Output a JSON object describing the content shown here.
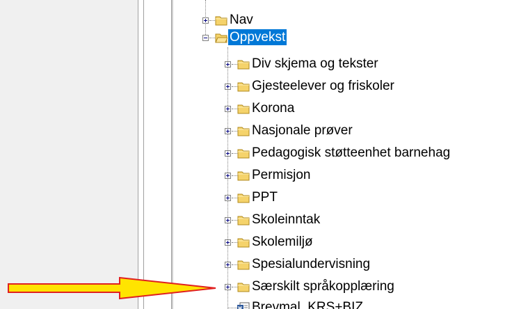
{
  "colors": {
    "selection": "#0078d7",
    "folder_fill": "#f5d36b",
    "folder_stroke": "#b08a1e",
    "arrow_fill": "#ffe400",
    "arrow_stroke": "#e02020"
  },
  "tree": {
    "top_nodes": [
      {
        "label": "Nav",
        "expanded": false,
        "icon": "folder-icon"
      },
      {
        "label": "Oppvekst",
        "expanded": true,
        "selected": true,
        "icon": "folder-open-icon"
      }
    ],
    "children": [
      {
        "label": "Div skjema og tekster",
        "icon": "folder-icon"
      },
      {
        "label": "Gjesteelever og friskoler",
        "icon": "folder-icon"
      },
      {
        "label": "Korona",
        "icon": "folder-icon"
      },
      {
        "label": "Nasjonale prøver",
        "icon": "folder-icon"
      },
      {
        "label": "Pedagogisk støtteenhet barnehag",
        "icon": "folder-icon"
      },
      {
        "label": "Permisjon",
        "icon": "folder-icon"
      },
      {
        "label": "PPT",
        "icon": "folder-icon"
      },
      {
        "label": "Skoleinntak",
        "icon": "folder-icon"
      },
      {
        "label": "Skolemiljø",
        "icon": "folder-icon"
      },
      {
        "label": "Spesialundervisning",
        "icon": "folder-icon"
      },
      {
        "label": "Særskilt språkopplæring",
        "icon": "folder-icon"
      },
      {
        "label": "Brevmal_KRS+BIZ",
        "icon": "word-document-icon"
      }
    ]
  },
  "annotation": {
    "icon": "pointer-arrow-icon",
    "points_to": "Særskilt språkopplæring"
  }
}
